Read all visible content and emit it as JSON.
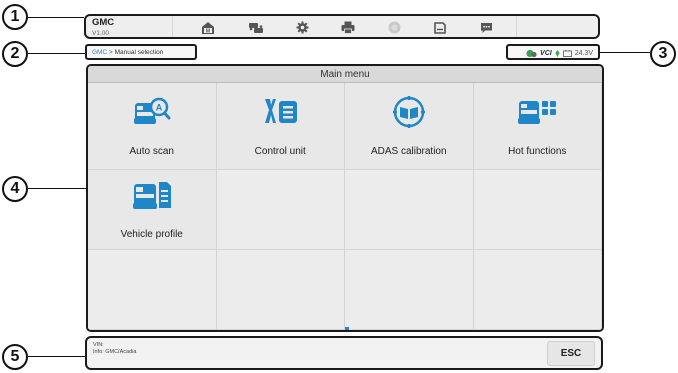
{
  "callouts": [
    "1",
    "2",
    "3",
    "4",
    "5"
  ],
  "toolbar": {
    "make": "GMC",
    "version": "V1.00",
    "buttons": [
      "home-icon",
      "vehicle-swap-icon",
      "settings-icon",
      "print-icon",
      "help-icon",
      "save-icon",
      "data-logging-icon"
    ]
  },
  "breadcrumb": {
    "link": "GMC",
    "separator": " > ",
    "current": "Manual selection"
  },
  "status": {
    "vci_label": "VCI",
    "voltage": "24.3V"
  },
  "main": {
    "header": "Main menu",
    "tiles": [
      {
        "label": "Auto scan",
        "icon": "auto-scan-icon"
      },
      {
        "label": "Control unit",
        "icon": "control-unit-icon"
      },
      {
        "label": "ADAS calibration",
        "icon": "adas-calibration-icon"
      },
      {
        "label": "Hot functions",
        "icon": "hot-functions-icon"
      },
      {
        "label": "Vehicle profile",
        "icon": "vehicle-profile-icon"
      }
    ]
  },
  "footer": {
    "vin_line": "VIN:",
    "info_line": "Info: GMC/Acadia",
    "esc_label": "ESC"
  },
  "colors": {
    "accent_blue": "#2e7ed6",
    "status_green": "#3aa34a"
  }
}
